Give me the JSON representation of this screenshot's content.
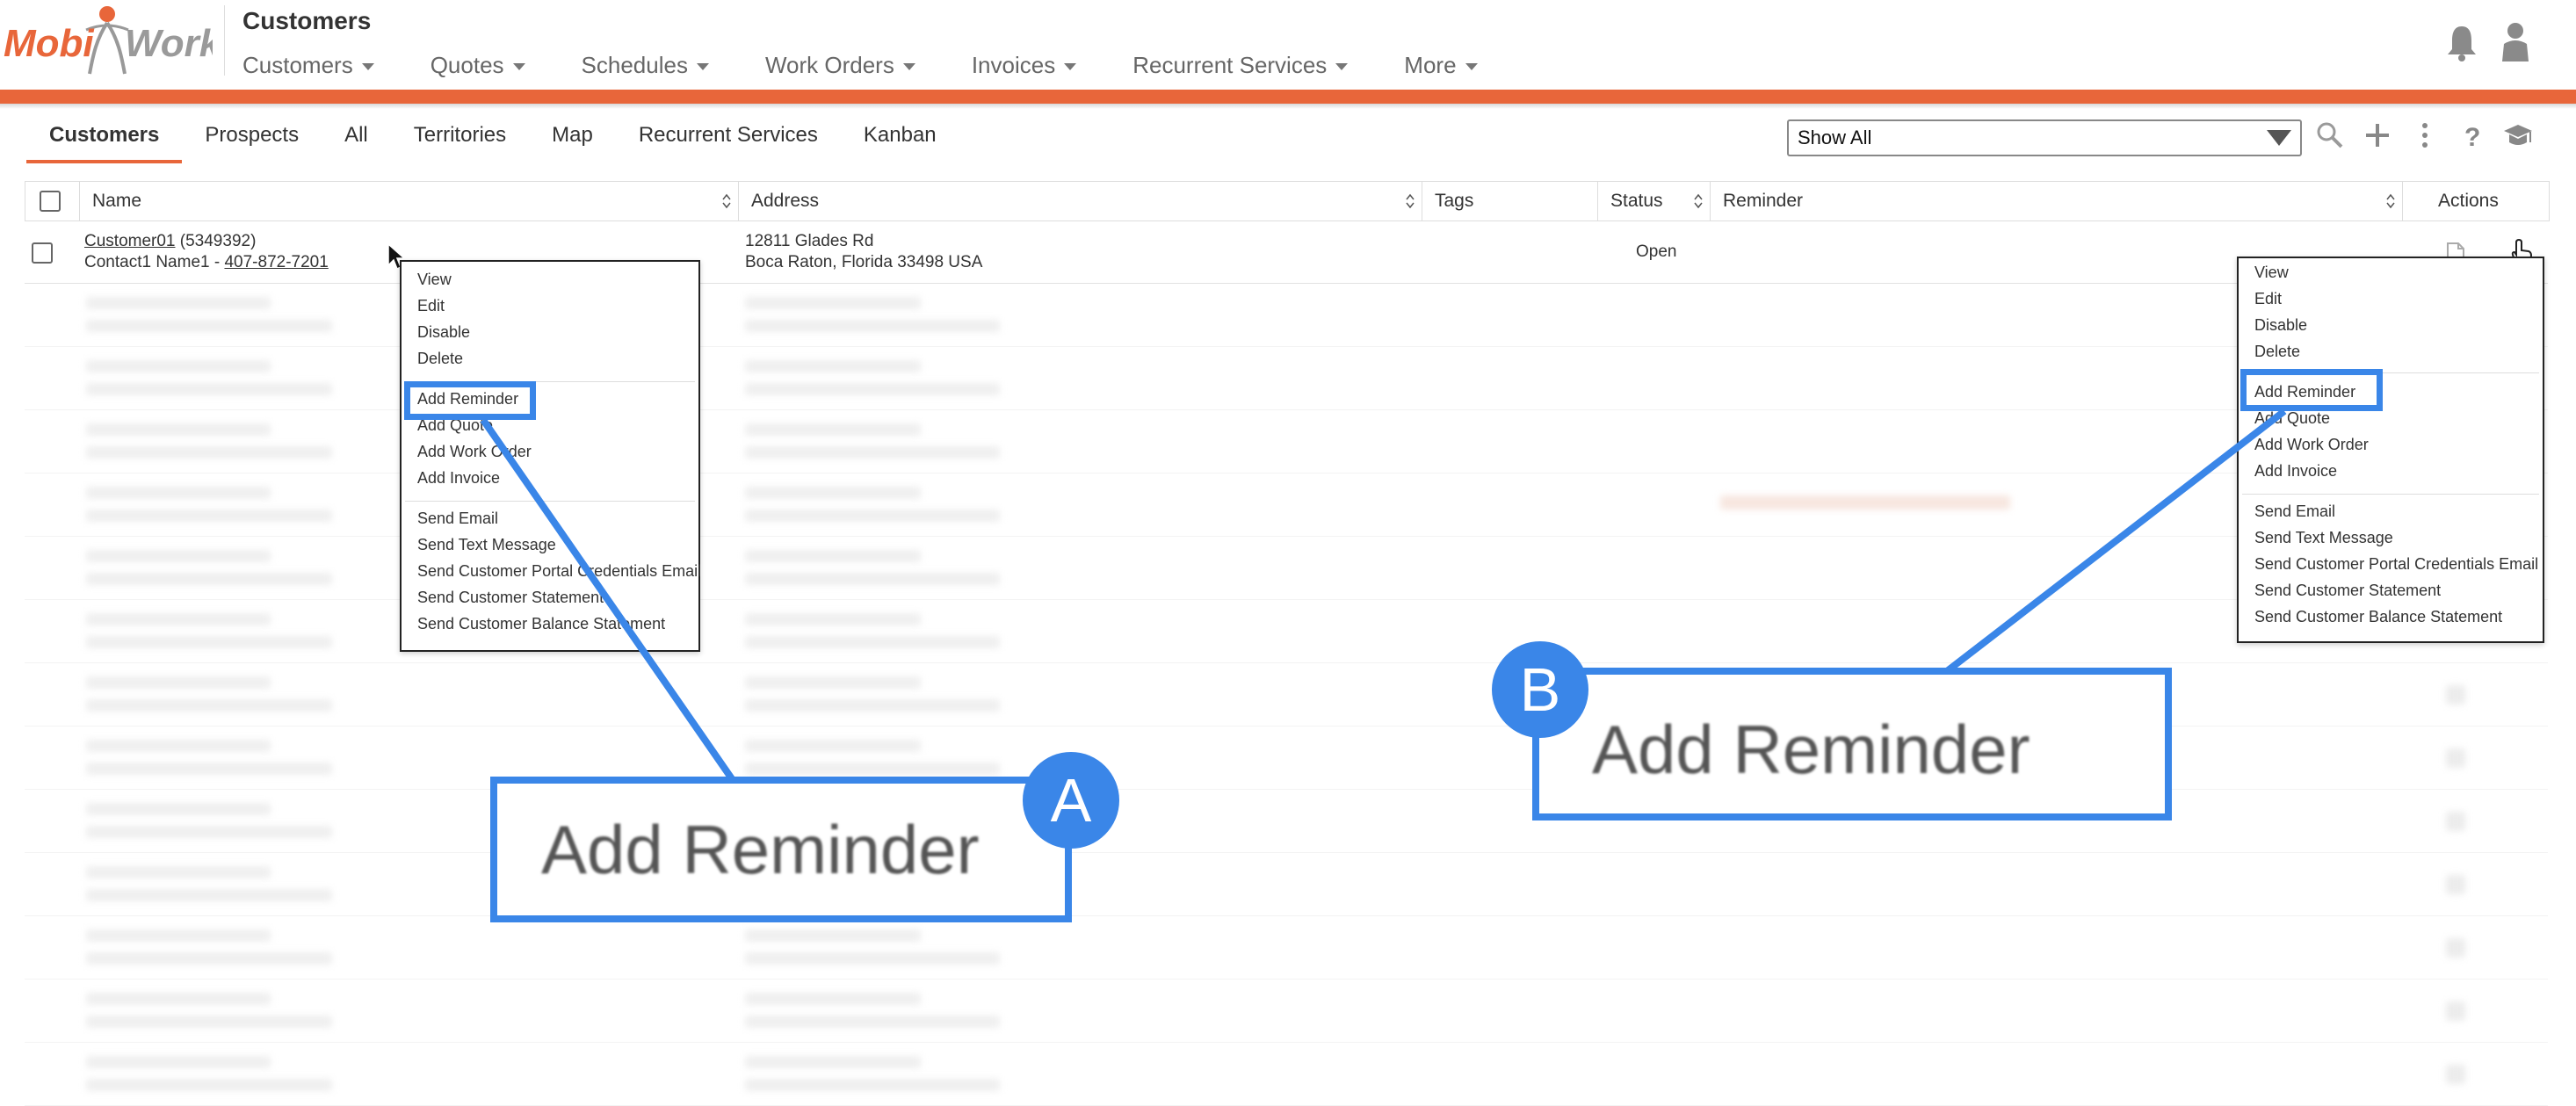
{
  "header": {
    "logo_text_left": "Mobi",
    "logo_text_right": "Work",
    "page_title": "Customers",
    "nav": [
      {
        "label": "Customers"
      },
      {
        "label": "Quotes"
      },
      {
        "label": "Schedules"
      },
      {
        "label": "Work Orders"
      },
      {
        "label": "Invoices"
      },
      {
        "label": "Recurrent Services"
      },
      {
        "label": "More"
      }
    ],
    "accent_color": "#e8663a"
  },
  "subtabs": [
    {
      "label": "Customers",
      "active": true
    },
    {
      "label": "Prospects"
    },
    {
      "label": "All"
    },
    {
      "label": "Territories"
    },
    {
      "label": "Map"
    },
    {
      "label": "Recurrent Services"
    },
    {
      "label": "Kanban"
    }
  ],
  "filter": {
    "selected": "Show All"
  },
  "toolbar_icons": [
    "search-icon",
    "plus-icon",
    "kebab-menu-icon",
    "help-icon",
    "graduation-cap-icon"
  ],
  "table": {
    "columns": [
      "Name",
      "Address",
      "Tags",
      "Status",
      "Reminder",
      "Actions"
    ],
    "row": {
      "customer_name": "Customer01",
      "customer_id": "(5349392)",
      "contact_prefix": "Contact1 Name1 -",
      "phone": "407-872-7201",
      "address_line1": "12811 Glades Rd",
      "address_line2": "Boca Raton,  Florida 33498  USA",
      "status": "Open"
    }
  },
  "menu": {
    "group1": [
      "View",
      "Edit",
      "Disable",
      "Delete"
    ],
    "group2": [
      "Add Reminder",
      "Add Quote",
      "Add Work Order",
      "Add Invoice"
    ],
    "group3": [
      "Send Email",
      "Send Text Message",
      "Send Customer Portal Credentials Email",
      "Send Customer Statement",
      "Send Customer Balance Statement"
    ]
  },
  "callouts": {
    "a": {
      "badge": "A",
      "text": "Add Reminder"
    },
    "b": {
      "badge": "B",
      "text": "Add Reminder"
    },
    "color": "#3a86e8"
  }
}
